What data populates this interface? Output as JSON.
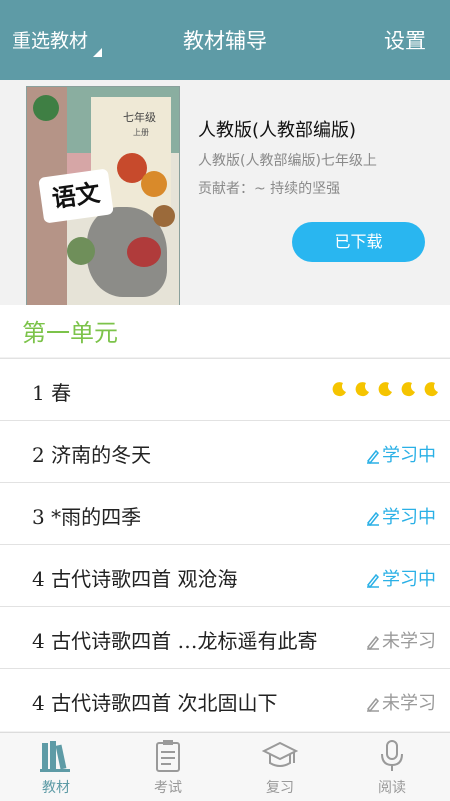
{
  "header": {
    "left_label": "重选教材",
    "title": "教材辅导",
    "right_label": "设置"
  },
  "book": {
    "cover_text": "语文",
    "cover_grade": "七年级",
    "cover_term": "上册",
    "name": "人教版(人教部编版)",
    "subtitle": "人教版(人教部编版)七年级上",
    "contributor": "贡献者：~ 持续的坚强",
    "download_label": "已下载"
  },
  "unit": {
    "title": "第一单元"
  },
  "lessons": [
    {
      "title": "1 春",
      "status": "",
      "status_type": "moons",
      "moons": 5
    },
    {
      "title": "2 济南的冬天",
      "status": "学习中",
      "status_type": "learning"
    },
    {
      "title": "3 *雨的四季",
      "status": "学习中",
      "status_type": "learning"
    },
    {
      "title": "4 古代诗歌四首 观沧海",
      "status": "学习中",
      "status_type": "learning"
    },
    {
      "title": "4 古代诗歌四首 …龙标遥有此寄",
      "status": "未学习",
      "status_type": "unlearned"
    },
    {
      "title": "4 古代诗歌四首 次北固山下",
      "status": "未学习",
      "status_type": "unlearned"
    }
  ],
  "tabs": [
    {
      "label": "教材",
      "icon": "books-icon",
      "active": true
    },
    {
      "label": "考试",
      "icon": "clipboard-icon",
      "active": false
    },
    {
      "label": "复习",
      "icon": "graduation-cap-icon",
      "active": false
    },
    {
      "label": "阅读",
      "icon": "microphone-icon",
      "active": false
    }
  ],
  "colors": {
    "header": "#5e9ba6",
    "accent_blue": "#29b6f0",
    "unit_green": "#7cc34a",
    "moon_yellow": "#f5c400"
  }
}
